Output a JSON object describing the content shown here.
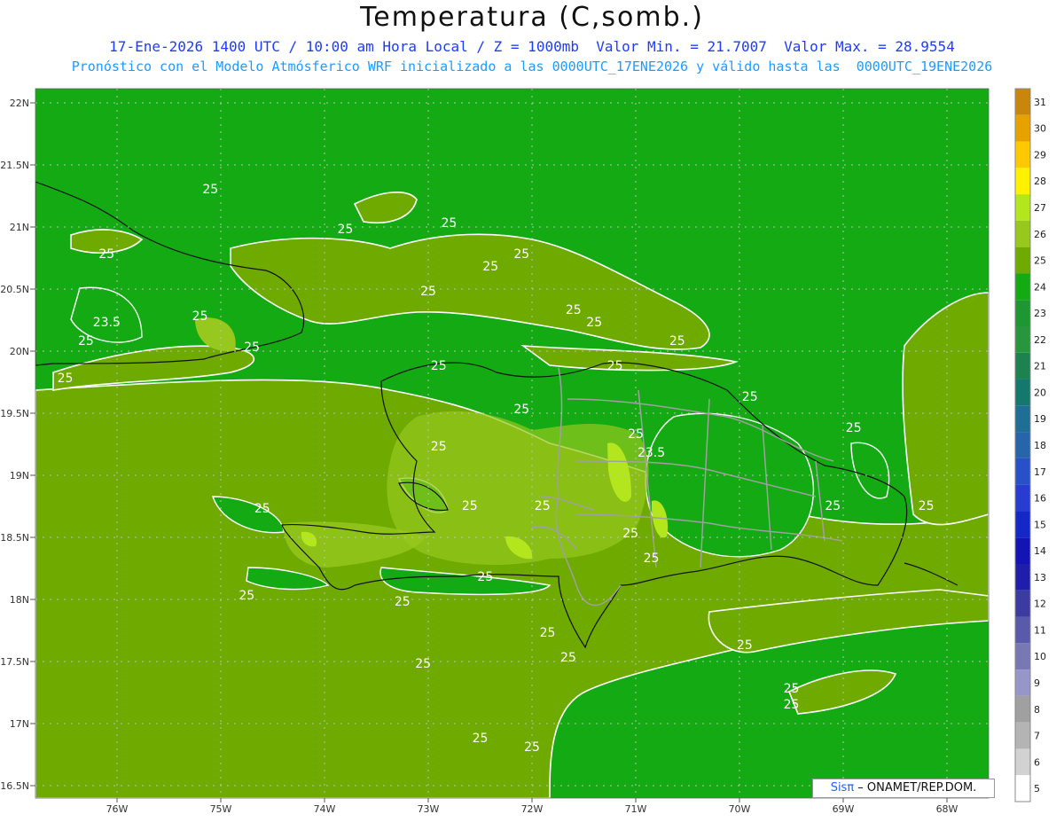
{
  "header": {
    "title": "Temperatura (C,somb.)",
    "subtitle_line1": "17-Ene-2026 1400 UTC / 10:00 am Hora Local / Z = 1000mb  Valor Min. = 21.7007  Valor Max. = 28.9554",
    "subtitle_line2": "Pronóstico con el Modelo Atmósferico WRF inicializado a las 0000UTC_17ENE2026 y válido hasta las  0000UTC_19ENE2026"
  },
  "map": {
    "lat_ticks": [
      "22N",
      "21.5N",
      "21N",
      "20.5N",
      "20N",
      "19.5N",
      "19N",
      "18.5N",
      "18N",
      "17.5N",
      "17N",
      "16.5N"
    ],
    "lon_ticks": [
      "76W",
      "75W",
      "74W",
      "73W",
      "72W",
      "71W",
      "70W",
      "69W",
      "68W"
    ],
    "contour_labels": [
      {
        "text": "25",
        "lon": -75.1,
        "lat": 21.27
      },
      {
        "text": "25",
        "lon": -72.8,
        "lat": 21.0
      },
      {
        "text": "25",
        "lon": -76.1,
        "lat": 20.75
      },
      {
        "text": "25",
        "lon": -73.8,
        "lat": 20.95
      },
      {
        "text": "25",
        "lon": -72.1,
        "lat": 20.75
      },
      {
        "text": "25",
        "lon": -72.4,
        "lat": 20.65
      },
      {
        "text": "25",
        "lon": -73.0,
        "lat": 20.45
      },
      {
        "text": "23.5",
        "lon": -76.1,
        "lat": 20.2
      },
      {
        "text": "25",
        "lon": -75.2,
        "lat": 20.25
      },
      {
        "text": "25",
        "lon": -74.7,
        "lat": 20.0
      },
      {
        "text": "25",
        "lon": -76.3,
        "lat": 20.05
      },
      {
        "text": "25",
        "lon": -76.5,
        "lat": 19.75
      },
      {
        "text": "25",
        "lon": -71.6,
        "lat": 20.3
      },
      {
        "text": "25",
        "lon": -71.4,
        "lat": 20.2
      },
      {
        "text": "25",
        "lon": -70.6,
        "lat": 20.05
      },
      {
        "text": "25",
        "lon": -72.9,
        "lat": 19.85
      },
      {
        "text": "25",
        "lon": -71.2,
        "lat": 19.85
      },
      {
        "text": "25",
        "lon": -69.9,
        "lat": 19.6
      },
      {
        "text": "25",
        "lon": -72.1,
        "lat": 19.5
      },
      {
        "text": "25",
        "lon": -68.9,
        "lat": 19.35
      },
      {
        "text": "25",
        "lon": -72.9,
        "lat": 19.2
      },
      {
        "text": "25",
        "lon": -71.0,
        "lat": 19.3
      },
      {
        "text": "23.5",
        "lon": -70.85,
        "lat": 19.15
      },
      {
        "text": "25",
        "lon": -74.6,
        "lat": 18.7
      },
      {
        "text": "25",
        "lon": -72.6,
        "lat": 18.72
      },
      {
        "text": "25",
        "lon": -71.9,
        "lat": 18.72
      },
      {
        "text": "25",
        "lon": -69.1,
        "lat": 18.72
      },
      {
        "text": "25",
        "lon": -68.2,
        "lat": 18.72
      },
      {
        "text": "25",
        "lon": -71.05,
        "lat": 18.5
      },
      {
        "text": "25",
        "lon": -70.85,
        "lat": 18.3
      },
      {
        "text": "25",
        "lon": -72.45,
        "lat": 18.15
      },
      {
        "text": "25",
        "lon": -74.75,
        "lat": 18.0
      },
      {
        "text": "25",
        "lon": -73.25,
        "lat": 17.95
      },
      {
        "text": "25",
        "lon": -71.85,
        "lat": 17.7
      },
      {
        "text": "25",
        "lon": -71.65,
        "lat": 17.5
      },
      {
        "text": "25",
        "lon": -73.05,
        "lat": 17.45
      },
      {
        "text": "25",
        "lon": -69.95,
        "lat": 17.6
      },
      {
        "text": "25",
        "lon": -69.5,
        "lat": 17.25
      },
      {
        "text": "25",
        "lon": -69.5,
        "lat": 17.12
      },
      {
        "text": "25",
        "lon": -72.5,
        "lat": 16.85
      },
      {
        "text": "25",
        "lon": -72.0,
        "lat": 16.78
      }
    ]
  },
  "colorbar": {
    "labels": [
      "31",
      "30",
      "29",
      "28",
      "27",
      "26",
      "25",
      "24",
      "23",
      "22",
      "21",
      "20",
      "19",
      "18",
      "17",
      "16",
      "15",
      "14",
      "13",
      "12",
      "11",
      "10",
      "9",
      "8",
      "7",
      "6",
      "5"
    ],
    "colors": [
      "#c8870a",
      "#e6a300",
      "#ffc800",
      "#fff200",
      "#b4e61e",
      "#96c81e",
      "#6eaa00",
      "#14aa14",
      "#1e9632",
      "#28963c",
      "#1e8250",
      "#14786e",
      "#1e6e96",
      "#2864aa",
      "#2850c8",
      "#283cd2",
      "#1428c8",
      "#1414b4",
      "#1e1eaa",
      "#3c3ca0",
      "#5a5aaa",
      "#7878b4",
      "#9696c8",
      "#a0a0a0",
      "#b4b4b4",
      "#d2d2d2",
      "#ffffff"
    ]
  },
  "credit": {
    "sis": "Sis",
    "pi": "π",
    "text": " –  ONAMET/REP.DOM."
  }
}
